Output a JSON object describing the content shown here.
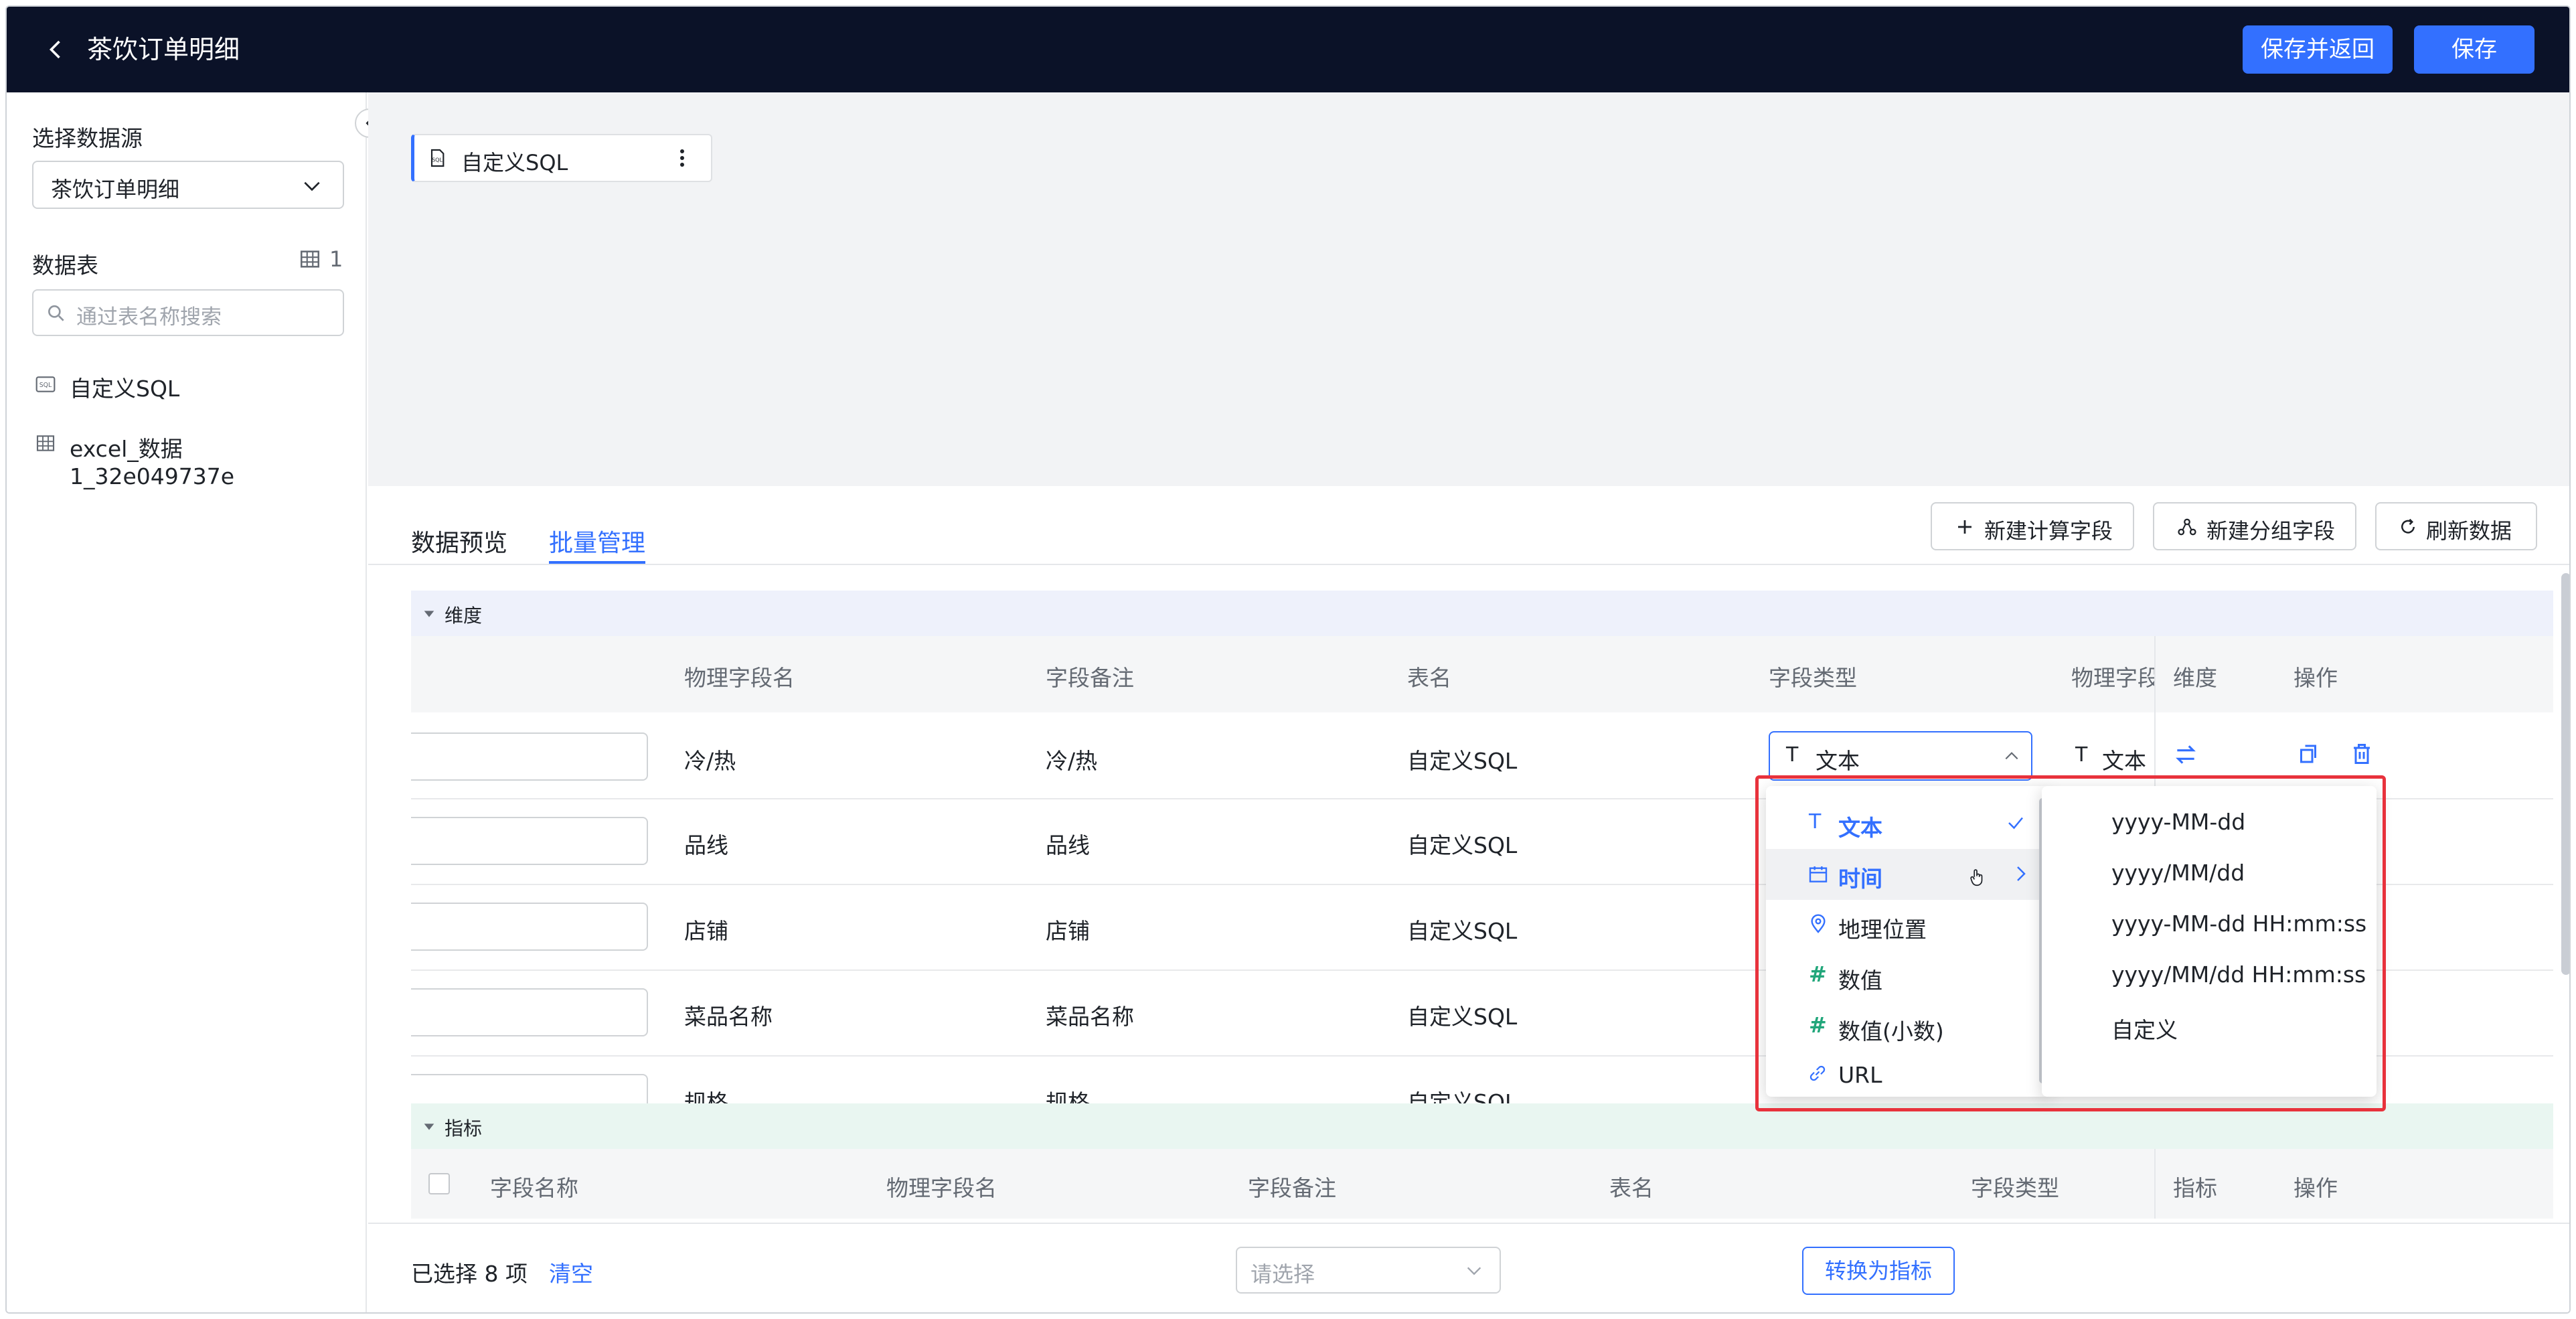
{
  "header": {
    "title": "茶饮订单明细",
    "save_return_label": "保存并返回",
    "save_label": "保存"
  },
  "sidebar": {
    "datasource_label": "选择数据源",
    "datasource_value": "茶饮订单明细",
    "tables_label": "数据表",
    "tables_count": "1",
    "search_placeholder": "通过表名称搜索",
    "tables": [
      {
        "name": "自定义SQL",
        "icon": "sql-icon"
      },
      {
        "name": "excel_数据1_32e049737e",
        "icon": "table-icon"
      }
    ]
  },
  "canvas": {
    "node_label": "自定义SQL"
  },
  "panel": {
    "tabs": [
      "数据预览",
      "批量管理"
    ],
    "active_tab": "批量管理",
    "actions": {
      "new_calc": "新建计算字段",
      "new_group": "新建分组字段",
      "refresh": "刷新数据"
    }
  },
  "dimension": {
    "group_label": "维度",
    "columns": [
      "物理字段名",
      "字段备注",
      "表名",
      "字段类型",
      "物理字段",
      "维度",
      "操作"
    ],
    "rows": [
      {
        "physical": "冷/热",
        "note": "冷/热",
        "table": "自定义SQL",
        "type": "文本",
        "phys_type": "文本"
      },
      {
        "physical": "品线",
        "note": "品线",
        "table": "自定义SQL"
      },
      {
        "physical": "店铺",
        "note": "店铺",
        "table": "自定义SQL"
      },
      {
        "physical": "菜品名称",
        "note": "菜品名称",
        "table": "自定义SQL"
      },
      {
        "physical": "规格",
        "note": "规格",
        "table": "自定义SQL"
      }
    ]
  },
  "type_menu": {
    "items": [
      {
        "label": "文本",
        "icon": "text-type-icon",
        "selected": true
      },
      {
        "label": "时间",
        "icon": "calendar-icon",
        "hover": true
      },
      {
        "label": "地理位置",
        "icon": "location-icon"
      },
      {
        "label": "数值",
        "icon": "hash-icon"
      },
      {
        "label": "数值(小数)",
        "icon": "hash-icon"
      },
      {
        "label": "URL",
        "icon": "link-icon"
      }
    ],
    "submenu": [
      "yyyy-MM-dd",
      "yyyy/MM/dd",
      "yyyy-MM-dd HH:mm:ss",
      "yyyy/MM/dd HH:mm:ss",
      "自定义"
    ]
  },
  "metric": {
    "group_label": "指标",
    "columns": [
      "字段名称",
      "物理字段名",
      "字段备注",
      "表名",
      "字段类型",
      "指标",
      "操作"
    ]
  },
  "footer": {
    "selected_text": "已选择 8 项",
    "clear_label": "清空",
    "select_placeholder": "请选择",
    "convert_label": "转换为指标"
  },
  "colors": {
    "accent": "#3370ff",
    "header_bg": "#0b1228",
    "highlight": "#e8323c"
  }
}
